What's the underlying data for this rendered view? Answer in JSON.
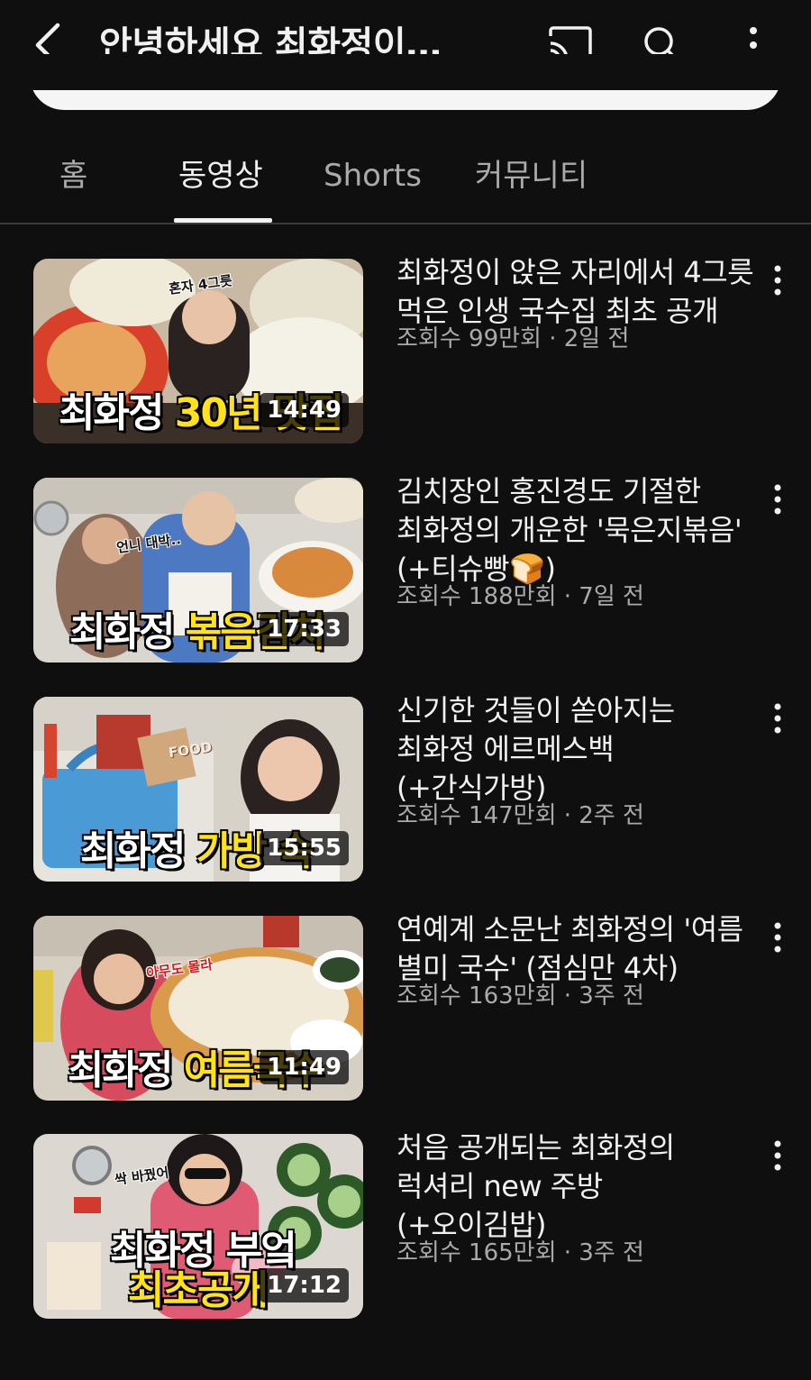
{
  "header": {
    "channel_title": "안녕하세요 최화정이…",
    "back_icon": "chevron-left-icon",
    "cast_icon": "cast-icon",
    "search_icon": "search-icon",
    "more_icon": "more-vertical-icon"
  },
  "tabs": [
    {
      "label": "홈",
      "active": false
    },
    {
      "label": "동영상",
      "active": true
    },
    {
      "label": "Shorts",
      "active": false
    },
    {
      "label": "커뮤니티",
      "active": false
    }
  ],
  "videos": [
    {
      "title": "최화정이 앉은 자리에서 4그릇 먹은 인생 국수집 최초 공개",
      "views": "조회수 99만회",
      "age": "2일 전",
      "duration": "14:49",
      "thumb_text": "최화정",
      "thumb_highlight": "30년 맛집",
      "thumb_sticker": "혼자 4그릇"
    },
    {
      "title": "김치장인 홍진경도 기절한 최화정의 개운한 '묵은지볶음' (+티슈빵🍞)",
      "views": "조회수 188만회",
      "age": "7일 전",
      "duration": "17:33",
      "thumb_text": "최화정",
      "thumb_highlight": "볶음김치",
      "thumb_sticker": "언니 대박.."
    },
    {
      "title": "신기한 것들이 쏟아지는 최화정 에르메스백 (+간식가방)",
      "views": "조회수 147만회",
      "age": "2주 전",
      "duration": "15:55",
      "thumb_text": "최화정",
      "thumb_highlight": "가방 속",
      "thumb_sticker": "FOOD"
    },
    {
      "title": "연예계 소문난 최화정의 '여름 별미 국수' (점심만 4차)",
      "views": "조회수 163만회",
      "age": "3주 전",
      "duration": "11:49",
      "thumb_text": "최화정",
      "thumb_highlight": "여름국수",
      "thumb_sticker": "아무도 몰라"
    },
    {
      "title": "처음 공개되는 최화정의 럭셔리 new 주방 (+오이김밥)",
      "views": "조회수 165만회",
      "age": "3주 전",
      "duration": "17:12",
      "thumb_text": "최화정 부엌",
      "thumb_highlight": "최초공개",
      "thumb_sticker": "싹 바꿨어"
    }
  ],
  "stats_separator": " · ",
  "item_menu_icon": "more-vertical-icon",
  "colors": {
    "background": "#0f0f0f",
    "text_primary": "#f1f1f1",
    "text_secondary": "#aaaaaa",
    "thumb_highlight": "#ffe21a"
  }
}
